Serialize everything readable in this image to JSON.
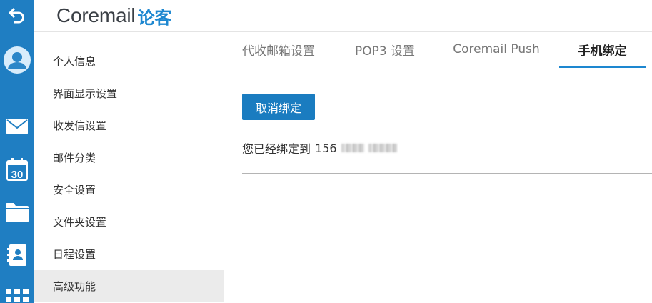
{
  "header": {
    "logo_word": "Coremail",
    "logo_sub": "论客"
  },
  "rail": {
    "calendar_day": "30",
    "icons": [
      "back-arrow-icon",
      "avatar",
      "mail-icon",
      "calendar-icon",
      "folder-icon",
      "contacts-icon",
      "apps-grid-icon"
    ]
  },
  "menu": {
    "items": [
      {
        "label": "个人信息"
      },
      {
        "label": "界面显示设置"
      },
      {
        "label": "收发信设置"
      },
      {
        "label": "邮件分类"
      },
      {
        "label": "安全设置"
      },
      {
        "label": "文件夹设置"
      },
      {
        "label": "日程设置"
      },
      {
        "label": "高级功能",
        "active": true
      }
    ]
  },
  "tabs": [
    {
      "label": "代收邮箱设置"
    },
    {
      "label": "POP3 设置"
    },
    {
      "label": "Coremail Push"
    },
    {
      "label": "手机绑定",
      "active": true
    }
  ],
  "content": {
    "unbind_button": "取消绑定",
    "bound_prefix": "您已经绑定到",
    "phone_visible": "156"
  },
  "colors": {
    "rail_bg": "#1f7ec2",
    "accent": "#1d87d0",
    "button_bg": "#1a7cc0",
    "active_menu_bg": "#ebebeb"
  }
}
